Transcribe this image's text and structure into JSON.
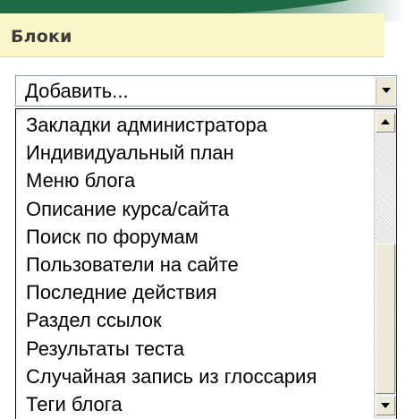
{
  "blocks_panel": {
    "title": "Блоки",
    "select": {
      "value": "Добавить..."
    },
    "options": [
      "Закладки администратора",
      "Индивидуальный план",
      "Меню блога",
      "Описание курса/сайта",
      "Поиск по форумам",
      "Пользователи на сайте",
      "Последние действия",
      "Раздел ссылок",
      "Результаты теста",
      "Случайная запись из глоссария",
      "Теги блога"
    ]
  },
  "colors": {
    "top_bar": "#1f6b45",
    "header_background": "#fbf6c9",
    "header_text": "#3b3b3b"
  },
  "icons": {
    "dropdown_arrow": "chevron-down-icon",
    "scroll_up": "arrow-up-icon",
    "scroll_down": "arrow-down-icon"
  }
}
